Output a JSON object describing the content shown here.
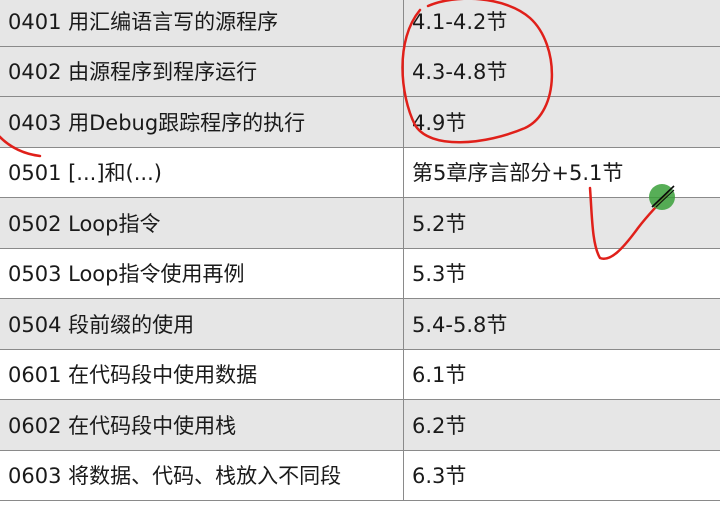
{
  "rows": [
    {
      "code_title": "0401 用汇编语言写的源程序",
      "section": "4.1-4.2节"
    },
    {
      "code_title": "0402 由源程序到程序运行",
      "section": "4.3-4.8节"
    },
    {
      "code_title": "0403 用Debug跟踪程序的执行",
      "section": "4.9节"
    },
    {
      "code_title": "0501 [...]和(...)",
      "section": "第5章序言部分+5.1节"
    },
    {
      "code_title": "0502 Loop指令",
      "section": "5.2节"
    },
    {
      "code_title": "0503 Loop指令使用再例",
      "section": "5.3节"
    },
    {
      "code_title": "0504 段前缀的使用",
      "section": "5.4-5.8节"
    },
    {
      "code_title": "0601 在代码段中使用数据",
      "section": "6.1节"
    },
    {
      "code_title": "0602 在代码段中使用栈",
      "section": "6.2节"
    },
    {
      "code_title": "0603 将数据、代码、栈放入不同段",
      "section": "6.3节"
    }
  ],
  "colors": {
    "shaded_row": "#e6e6e6",
    "border": "#8a8a8a",
    "ink": "#e0201a",
    "cursor": "#3aa03a"
  },
  "icons": {
    "cursor": "pen-cursor-icon"
  }
}
